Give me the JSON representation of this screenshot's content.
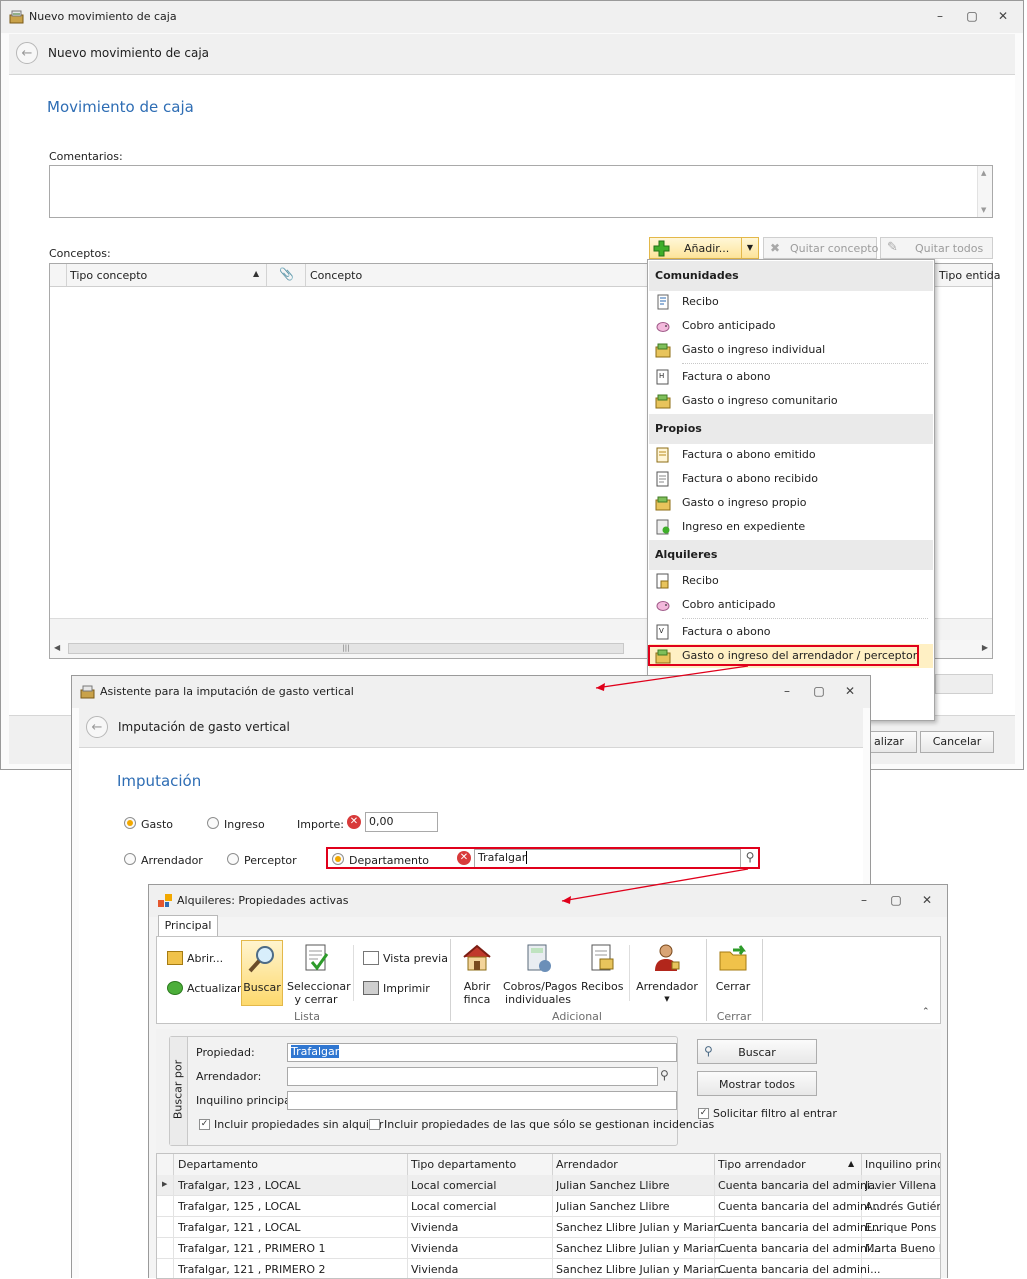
{
  "main_window": {
    "title": "Nuevo movimiento de caja",
    "header_title": "Nuevo movimiento de caja",
    "section_title": "Movimiento de caja",
    "comments_label": "Comentarios:",
    "concepts_label": "Conceptos:",
    "add_button": "Añadir...",
    "remove_button": "Quitar concepto",
    "remove_all_button": "Quitar todos",
    "columns": [
      "Tipo concepto",
      "Concepto",
      "Tipo entida"
    ],
    "finalize_button": "alizar",
    "cancel_button": "Cancelar"
  },
  "add_menu": {
    "groups": [
      {
        "title": "Comunidades",
        "items": [
          "Recibo",
          "Cobro anticipado",
          "Gasto o ingreso individual",
          "Factura o abono",
          "Gasto o ingreso comunitario"
        ]
      },
      {
        "title": "Propios",
        "items": [
          "Factura o abono emitido",
          "Factura o abono recibido",
          "Gasto o ingreso propio",
          "Ingreso en expediente"
        ]
      },
      {
        "title": "Alquileres",
        "items": [
          "Recibo",
          "Cobro anticipado",
          "Factura o abono",
          "Gasto o ingreso del arrendador / perceptor"
        ]
      }
    ]
  },
  "wizard": {
    "title": "Asistente para la imputación de gasto vertical",
    "header_title": "Imputación de gasto vertical",
    "section_title": "Imputación",
    "radio_gasto": "Gasto",
    "radio_ingreso": "Ingreso",
    "importe_label": "Importe:",
    "importe_value": "0,00",
    "radio_arrendador": "Arrendador",
    "radio_perceptor": "Perceptor",
    "radio_departamento": "Departamento",
    "departamento_value": "Trafalgar"
  },
  "search_window": {
    "title": "Alquileres: Propiedades activas",
    "tab": "Principal",
    "ribbon": {
      "abrir": "Abrir...",
      "actualizar": "Actualizar",
      "buscar": "Buscar",
      "seleccionar": "Seleccionar y cerrar",
      "vista_previa": "Vista previa",
      "imprimir": "Imprimir",
      "lista_group": "Lista",
      "abrir_finca": "Abrir finca",
      "cobros_pagos": "Cobros/Pagos individuales",
      "recibos": "Recibos",
      "arrendador": "Arrendador",
      "adicional_group": "Adicional",
      "cerrar": "Cerrar",
      "cerrar_group": "Cerrar"
    },
    "filter": {
      "side_label": "Buscar por",
      "propiedad_label": "Propiedad:",
      "propiedad_value": "Trafalgar",
      "arrendador_label": "Arrendador:",
      "inquilino_label": "Inquilino principal:",
      "chk_sin_alquilar": "Incluir propiedades sin alquilar",
      "chk_incidencias": "Incluir propiedades de las que sólo se gestionan incidencias",
      "buscar_button": "Buscar",
      "mostrar_todos_button": "Mostrar todos",
      "solicitar_filtro": "Solicitar filtro al entrar"
    },
    "columns": [
      "Departamento",
      "Tipo departamento",
      "Arrendador",
      "Tipo arrendador",
      "Inquilino princip"
    ],
    "rows": [
      [
        "Trafalgar, 123 , LOCAL",
        "Local comercial",
        "Julian Sanchez Llibre",
        "Cuenta bancaria del admini...",
        "Javier Villena Ga"
      ],
      [
        "Trafalgar, 125 , LOCAL",
        "Local comercial",
        "Julian Sanchez Llibre",
        "Cuenta bancaria del admini...",
        "Andrés Gutiérre"
      ],
      [
        "Trafalgar, 121 , LOCAL",
        "Vivienda",
        "Sanchez Llibre Julian y Marian...",
        "Cuenta bancaria del admini...",
        "Enrique Pons Vil"
      ],
      [
        "Trafalgar, 121 , PRIMERO 1",
        "Vivienda",
        "Sanchez Llibre Julian y Marian...",
        "Cuenta bancaria del admini...",
        "Marta Bueno La"
      ],
      [
        "Trafalgar, 121 , PRIMERO 2",
        "Vivienda",
        "Sanchez Llibre Julian y Marian...",
        "Cuenta bancaria del admini...",
        ""
      ]
    ]
  },
  "colors": {
    "accent_title": "#2e6db4",
    "highlight_red": "#e0001b",
    "selection_orange": "#f2a800",
    "selection_blue": "#3077d1"
  },
  "icons": [
    "app-icon",
    "back-arrow-icon",
    "minimize-icon",
    "maximize-icon",
    "close-icon",
    "add-plus-icon",
    "dropdown-arrow-icon",
    "remove-x-icon",
    "broom-icon",
    "attachment-icon",
    "sort-up-icon",
    "receipt-icon",
    "piggy-bank-icon",
    "money-icon",
    "invoice-icon",
    "document-icon",
    "search-icon",
    "folder-open-icon",
    "refresh-icon",
    "print-icon",
    "preview-icon",
    "house-icon",
    "calculator-icon",
    "person-icon",
    "exit-folder-icon",
    "collapse-icon"
  ]
}
